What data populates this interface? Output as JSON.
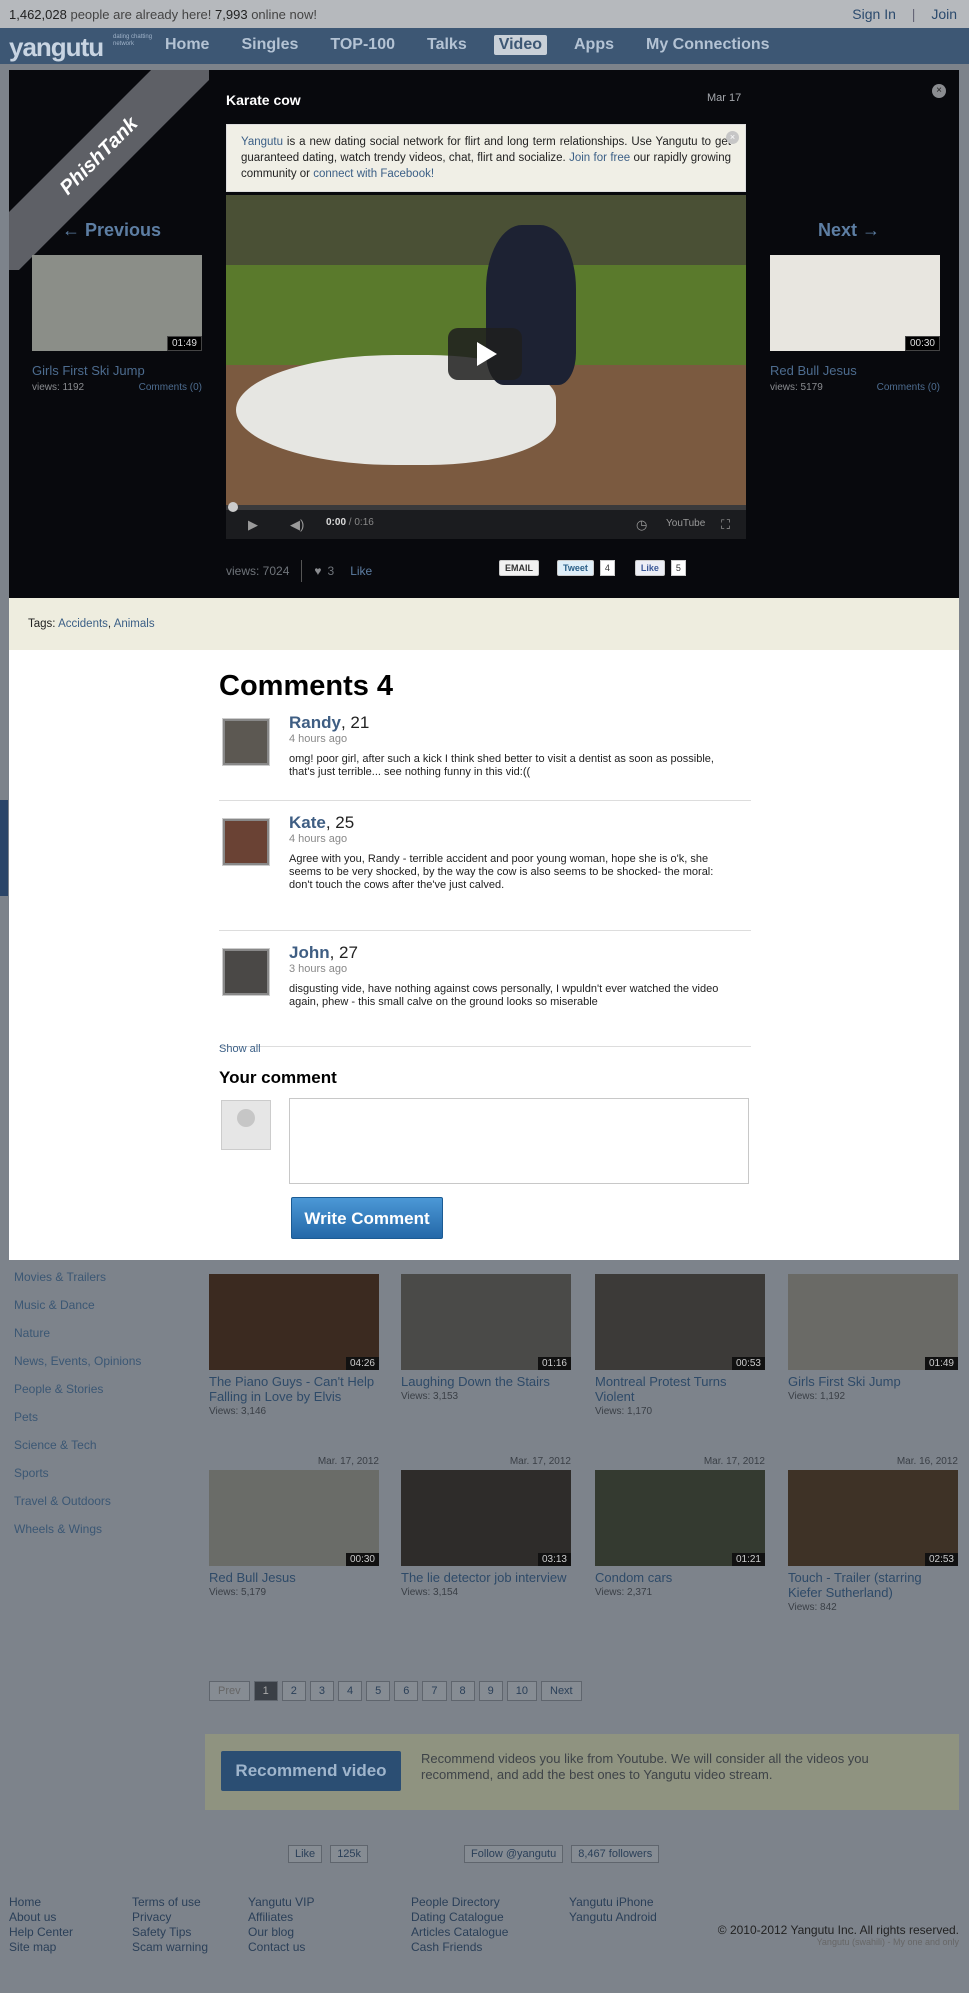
{
  "topbar": {
    "members_count": "1,462,028",
    "members_text": "people are already here!",
    "online_count": "7,993",
    "online_text": "online now!",
    "sign_in": "Sign In",
    "separator": "|",
    "join": "Join"
  },
  "navbar": {
    "logo": "yangutu",
    "logo_sub": "dating chatting network",
    "items": [
      "Home",
      "Singles",
      "TOP-100",
      "Talks",
      "Video",
      "Apps",
      "My Connections"
    ],
    "active": "Video"
  },
  "modal": {
    "ribbon": "PhishTank",
    "close_glyph": "×",
    "video": {
      "title": "Karate cow",
      "date": "Mar 17",
      "time_current": "0:00",
      "time_total": "/ 0:16",
      "progress": 0,
      "youtube_label": "YouTube",
      "views": "views: 7024",
      "likes": "3",
      "like_label": "Like"
    },
    "notice": {
      "brand": "Yangutu",
      "text1": " is a new dating social network for flirt and long term relationships. Use Yangutu to get guaranteed dating, watch trendy videos, chat, flirt and socialize. ",
      "join_link": "Join for free",
      "text2": " our rapidly growing community or ",
      "facebook_link": "connect with Facebook!",
      "close_glyph": "×"
    },
    "share": {
      "email": "EMAIL",
      "tweet": "Tweet",
      "tweet_count": "4",
      "like": "Like",
      "like_count": "5"
    },
    "previous": {
      "label": "← Previous",
      "duration": "01:49",
      "title": "Girls First Ski Jump",
      "views": "views: 1192",
      "comments": "Comments (0)"
    },
    "next": {
      "label": "Next →",
      "duration": "00:30",
      "title": "Red Bull Jesus",
      "views": "views: 5179",
      "comments": "Comments (0)"
    },
    "tags": {
      "label": "Tags:",
      "items": [
        "Accidents",
        "Animals"
      ]
    },
    "comments": {
      "heading": "Comments 4",
      "items": [
        {
          "name": "Randy",
          "age": ", 21",
          "time": "4 hours ago",
          "text": "omg! poor girl, after such a kick I think shed better to visit a dentist as soon as possible, that's just terrible... see nothing funny in this vid:(("
        },
        {
          "name": "Kate",
          "age": ", 25",
          "time": "4 hours ago",
          "text": "Agree with you, Randy - terrible accident and poor young woman, hope she is o'k, she seems to be very shocked, by the way the cow is also seems to be shocked- the moral: don't touch the cows after the've just calved."
        },
        {
          "name": "John",
          "age": ", 27",
          "time": "3 hours ago",
          "text": "disgusting vide, have nothing against cows personally, I wpuldn't ever watched the video again, phew - this small calve on the ground looks so miserable"
        }
      ],
      "show_all": "Show all",
      "your_comment": "Your comment",
      "write_button": "Write Comment"
    }
  },
  "categories": [
    "Movies & Trailers",
    "Music & Dance",
    "Nature",
    "News, Events, Opinions",
    "People & Stories",
    "Pets",
    "Science & Tech",
    "Sports",
    "Travel & Outdoors",
    "Wheels & Wings"
  ],
  "videos_row1": [
    {
      "date": "",
      "duration": "04:26",
      "title": "The Piano Guys - Can't Help Falling in Love by Elvis",
      "views": "Views: 3,146"
    },
    {
      "date": "",
      "duration": "01:16",
      "title": "Laughing Down the Stairs",
      "views": "Views: 3,153"
    },
    {
      "date": "",
      "duration": "00:53",
      "title": "Montreal Protest Turns Violent",
      "views": "Views: 1,170"
    },
    {
      "date": "",
      "duration": "01:49",
      "title": "Girls First Ski Jump",
      "views": "Views: 1,192"
    }
  ],
  "videos_row2": [
    {
      "date": "Mar. 17, 2012",
      "duration": "00:30",
      "title": "Red Bull Jesus",
      "views": "Views: 5,179"
    },
    {
      "date": "Mar. 17, 2012",
      "duration": "03:13",
      "title": "The lie detector job interview",
      "views": "Views: 3,154"
    },
    {
      "date": "Mar. 17, 2012",
      "duration": "01:21",
      "title": "Condom cars",
      "views": "Views: 2,371"
    },
    {
      "date": "Mar. 16, 2012",
      "duration": "02:53",
      "title": "Touch - Trailer (starring Kiefer Sutherland)",
      "views": "Views: 842"
    }
  ],
  "pager": {
    "prev": "Prev",
    "pages": [
      "1",
      "2",
      "3",
      "4",
      "5",
      "6",
      "7",
      "8",
      "9",
      "10"
    ],
    "current": "1",
    "next": "Next"
  },
  "recommend": {
    "button": "Recommend video",
    "text": "Recommend videos you like from Youtube. We will consider all the videos you recommend, and add the best ones to Yangutu video stream."
  },
  "social_bottom": {
    "fb_like": "Like",
    "fb_count": "125k",
    "tw_follow": "Follow @yangutu",
    "tw_count": "8,467 followers"
  },
  "footer": {
    "col1": [
      "Home",
      "About us",
      "Help Center",
      "Site map"
    ],
    "col2": [
      "Terms of use",
      "Privacy",
      "Safety Tips",
      "Scam warning"
    ],
    "col3": [
      "Yangutu VIP",
      "Affiliates",
      "Our blog",
      "Contact us"
    ],
    "col4": [
      "People Directory",
      "Dating Catalogue",
      "Articles Catalogue",
      "Cash Friends"
    ],
    "col5": [
      "Yangutu iPhone",
      "Yangutu Android"
    ],
    "copyright": "© 2010-2012 Yangutu Inc. All rights reserved.",
    "tagline": "Yangutu (swahili) - My one and only"
  }
}
